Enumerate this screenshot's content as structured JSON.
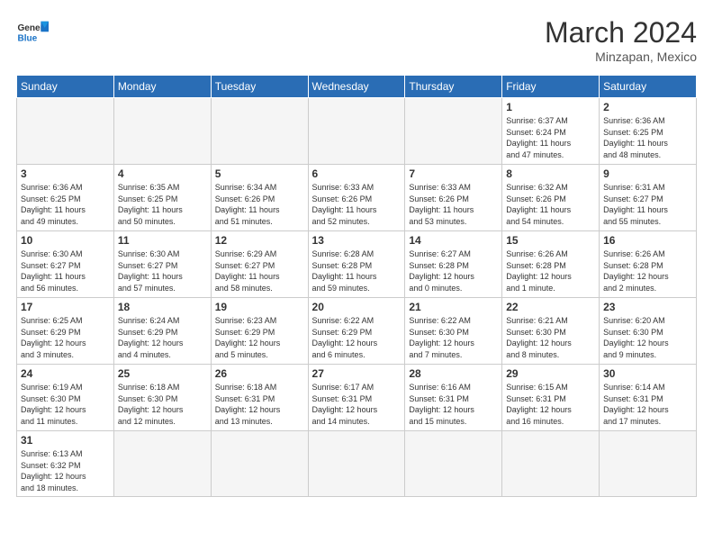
{
  "header": {
    "logo_text_general": "General",
    "logo_text_blue": "Blue",
    "month_year": "March 2024",
    "location": "Minzapan, Mexico"
  },
  "weekdays": [
    "Sunday",
    "Monday",
    "Tuesday",
    "Wednesday",
    "Thursday",
    "Friday",
    "Saturday"
  ],
  "weeks": [
    [
      {
        "day": "",
        "info": ""
      },
      {
        "day": "",
        "info": ""
      },
      {
        "day": "",
        "info": ""
      },
      {
        "day": "",
        "info": ""
      },
      {
        "day": "",
        "info": ""
      },
      {
        "day": "1",
        "info": "Sunrise: 6:37 AM\nSunset: 6:24 PM\nDaylight: 11 hours\nand 47 minutes."
      },
      {
        "day": "2",
        "info": "Sunrise: 6:36 AM\nSunset: 6:25 PM\nDaylight: 11 hours\nand 48 minutes."
      }
    ],
    [
      {
        "day": "3",
        "info": "Sunrise: 6:36 AM\nSunset: 6:25 PM\nDaylight: 11 hours\nand 49 minutes."
      },
      {
        "day": "4",
        "info": "Sunrise: 6:35 AM\nSunset: 6:25 PM\nDaylight: 11 hours\nand 50 minutes."
      },
      {
        "day": "5",
        "info": "Sunrise: 6:34 AM\nSunset: 6:26 PM\nDaylight: 11 hours\nand 51 minutes."
      },
      {
        "day": "6",
        "info": "Sunrise: 6:33 AM\nSunset: 6:26 PM\nDaylight: 11 hours\nand 52 minutes."
      },
      {
        "day": "7",
        "info": "Sunrise: 6:33 AM\nSunset: 6:26 PM\nDaylight: 11 hours\nand 53 minutes."
      },
      {
        "day": "8",
        "info": "Sunrise: 6:32 AM\nSunset: 6:26 PM\nDaylight: 11 hours\nand 54 minutes."
      },
      {
        "day": "9",
        "info": "Sunrise: 6:31 AM\nSunset: 6:27 PM\nDaylight: 11 hours\nand 55 minutes."
      }
    ],
    [
      {
        "day": "10",
        "info": "Sunrise: 6:30 AM\nSunset: 6:27 PM\nDaylight: 11 hours\nand 56 minutes."
      },
      {
        "day": "11",
        "info": "Sunrise: 6:30 AM\nSunset: 6:27 PM\nDaylight: 11 hours\nand 57 minutes."
      },
      {
        "day": "12",
        "info": "Sunrise: 6:29 AM\nSunset: 6:27 PM\nDaylight: 11 hours\nand 58 minutes."
      },
      {
        "day": "13",
        "info": "Sunrise: 6:28 AM\nSunset: 6:28 PM\nDaylight: 11 hours\nand 59 minutes."
      },
      {
        "day": "14",
        "info": "Sunrise: 6:27 AM\nSunset: 6:28 PM\nDaylight: 12 hours\nand 0 minutes."
      },
      {
        "day": "15",
        "info": "Sunrise: 6:26 AM\nSunset: 6:28 PM\nDaylight: 12 hours\nand 1 minute."
      },
      {
        "day": "16",
        "info": "Sunrise: 6:26 AM\nSunset: 6:28 PM\nDaylight: 12 hours\nand 2 minutes."
      }
    ],
    [
      {
        "day": "17",
        "info": "Sunrise: 6:25 AM\nSunset: 6:29 PM\nDaylight: 12 hours\nand 3 minutes."
      },
      {
        "day": "18",
        "info": "Sunrise: 6:24 AM\nSunset: 6:29 PM\nDaylight: 12 hours\nand 4 minutes."
      },
      {
        "day": "19",
        "info": "Sunrise: 6:23 AM\nSunset: 6:29 PM\nDaylight: 12 hours\nand 5 minutes."
      },
      {
        "day": "20",
        "info": "Sunrise: 6:22 AM\nSunset: 6:29 PM\nDaylight: 12 hours\nand 6 minutes."
      },
      {
        "day": "21",
        "info": "Sunrise: 6:22 AM\nSunset: 6:30 PM\nDaylight: 12 hours\nand 7 minutes."
      },
      {
        "day": "22",
        "info": "Sunrise: 6:21 AM\nSunset: 6:30 PM\nDaylight: 12 hours\nand 8 minutes."
      },
      {
        "day": "23",
        "info": "Sunrise: 6:20 AM\nSunset: 6:30 PM\nDaylight: 12 hours\nand 9 minutes."
      }
    ],
    [
      {
        "day": "24",
        "info": "Sunrise: 6:19 AM\nSunset: 6:30 PM\nDaylight: 12 hours\nand 11 minutes."
      },
      {
        "day": "25",
        "info": "Sunrise: 6:18 AM\nSunset: 6:30 PM\nDaylight: 12 hours\nand 12 minutes."
      },
      {
        "day": "26",
        "info": "Sunrise: 6:18 AM\nSunset: 6:31 PM\nDaylight: 12 hours\nand 13 minutes."
      },
      {
        "day": "27",
        "info": "Sunrise: 6:17 AM\nSunset: 6:31 PM\nDaylight: 12 hours\nand 14 minutes."
      },
      {
        "day": "28",
        "info": "Sunrise: 6:16 AM\nSunset: 6:31 PM\nDaylight: 12 hours\nand 15 minutes."
      },
      {
        "day": "29",
        "info": "Sunrise: 6:15 AM\nSunset: 6:31 PM\nDaylight: 12 hours\nand 16 minutes."
      },
      {
        "day": "30",
        "info": "Sunrise: 6:14 AM\nSunset: 6:31 PM\nDaylight: 12 hours\nand 17 minutes."
      }
    ],
    [
      {
        "day": "31",
        "info": "Sunrise: 6:13 AM\nSunset: 6:32 PM\nDaylight: 12 hours\nand 18 minutes."
      },
      {
        "day": "",
        "info": ""
      },
      {
        "day": "",
        "info": ""
      },
      {
        "day": "",
        "info": ""
      },
      {
        "day": "",
        "info": ""
      },
      {
        "day": "",
        "info": ""
      },
      {
        "day": "",
        "info": ""
      }
    ]
  ]
}
